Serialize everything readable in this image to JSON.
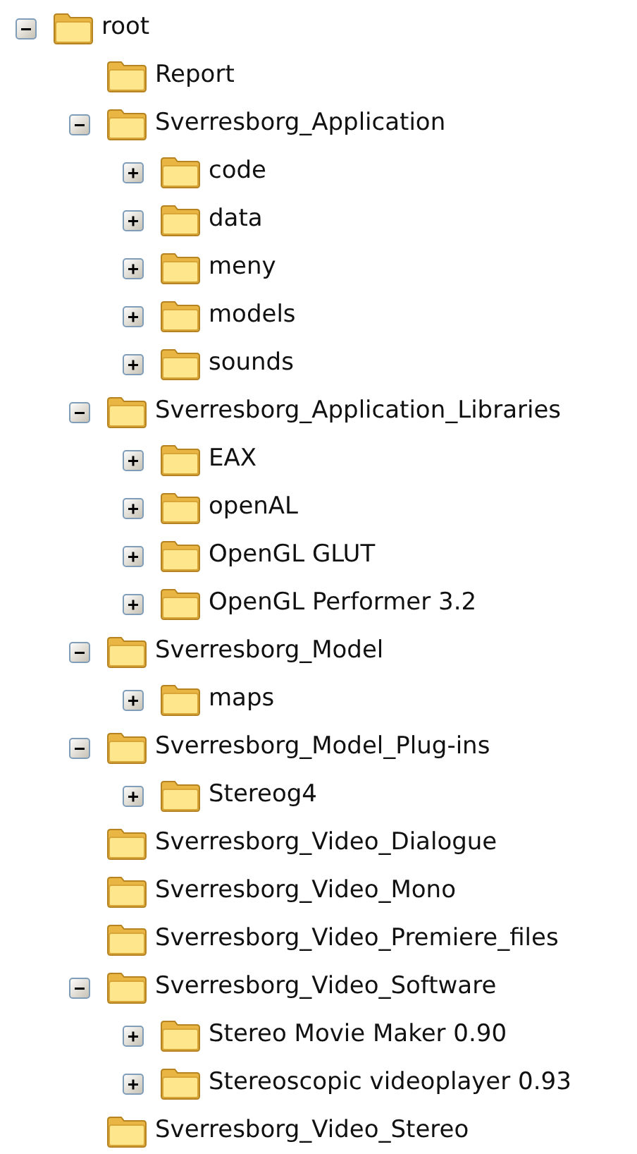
{
  "tree": [
    {
      "label": "root",
      "kind": "expandable",
      "expanded": true,
      "children": [
        {
          "label": "Report",
          "kind": "plain"
        },
        {
          "label": "Sverresborg_Application",
          "kind": "expandable",
          "expanded": true,
          "children": [
            {
              "label": "code",
              "kind": "expandable",
              "expanded": false
            },
            {
              "label": "data",
              "kind": "expandable",
              "expanded": false
            },
            {
              "label": "meny",
              "kind": "expandable",
              "expanded": false
            },
            {
              "label": "models",
              "kind": "expandable",
              "expanded": false
            },
            {
              "label": "sounds",
              "kind": "expandable",
              "expanded": false
            }
          ]
        },
        {
          "label": "Sverresborg_Application_Libraries",
          "kind": "expandable",
          "expanded": true,
          "children": [
            {
              "label": "EAX",
              "kind": "expandable",
              "expanded": false
            },
            {
              "label": "openAL",
              "kind": "expandable",
              "expanded": false
            },
            {
              "label": "OpenGL GLUT",
              "kind": "expandable",
              "expanded": false
            },
            {
              "label": "OpenGL Performer 3.2",
              "kind": "expandable",
              "expanded": false
            }
          ]
        },
        {
          "label": "Sverresborg_Model",
          "kind": "expandable",
          "expanded": true,
          "children": [
            {
              "label": "maps",
              "kind": "expandable",
              "expanded": false
            }
          ]
        },
        {
          "label": "Sverresborg_Model_Plug-ins",
          "kind": "expandable",
          "expanded": true,
          "children": [
            {
              "label": "Stereog4",
              "kind": "expandable",
              "expanded": false
            }
          ]
        },
        {
          "label": "Sverresborg_Video_Dialogue",
          "kind": "plain"
        },
        {
          "label": "Sverresborg_Video_Mono",
          "kind": "plain"
        },
        {
          "label": "Sverresborg_Video_Premiere_files",
          "kind": "plain"
        },
        {
          "label": "Sverresborg_Video_Software",
          "kind": "expandable",
          "expanded": true,
          "children": [
            {
              "label": "Stereo Movie Maker 0.90",
              "kind": "expandable",
              "expanded": false
            },
            {
              "label": "Stereoscopic videoplayer 0.93",
              "kind": "expandable",
              "expanded": false
            }
          ]
        },
        {
          "label": "Sverresborg_Video_Stereo",
          "kind": "plain"
        }
      ]
    }
  ]
}
